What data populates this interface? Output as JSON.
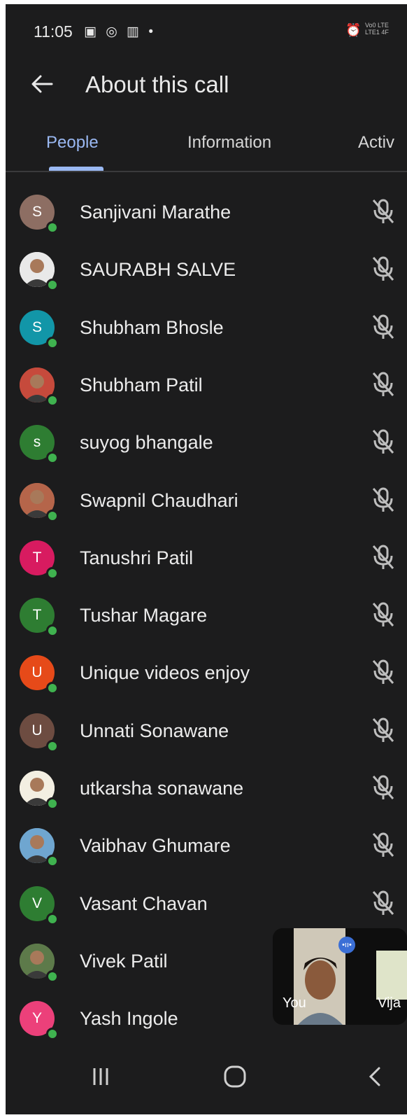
{
  "status_bar": {
    "time": "11:05",
    "left_icons": [
      "gallery-icon",
      "whatsapp-icon",
      "book-icon",
      "dot-icon"
    ],
    "right_icons": [
      "alarm-icon",
      "volte-lte-icon"
    ],
    "network_text_line1": "Vo0 LTE",
    "network_text_line2": "LTE1 4F"
  },
  "app_bar": {
    "title": "About this call"
  },
  "tabs": [
    {
      "label": "People",
      "active": true
    },
    {
      "label": "Information",
      "active": false
    },
    {
      "label": "Activ",
      "active": false
    }
  ],
  "colors": {
    "background": "#1c1c1d",
    "accent": "#9ab8f2",
    "presence": "#3fb24f"
  },
  "participants": [
    {
      "name": "Sanjivani Marathe",
      "initial": "S",
      "avatar_color": "#8d6e63",
      "photo": false,
      "mic": "muted"
    },
    {
      "name": "SAURABH SALVE",
      "initial": "",
      "avatar_color": "#e9e9e9",
      "photo": true,
      "mic": "muted"
    },
    {
      "name": "Shubham Bhosle",
      "initial": "S",
      "avatar_color": "#1296a8",
      "photo": false,
      "mic": "muted"
    },
    {
      "name": "Shubham Patil",
      "initial": "",
      "avatar_color": "#c64a3c",
      "photo": true,
      "mic": "muted"
    },
    {
      "name": "suyog bhangale",
      "initial": "s",
      "avatar_color": "#2e7d32",
      "photo": false,
      "mic": "muted"
    },
    {
      "name": "Swapnil Chaudhari",
      "initial": "",
      "avatar_color": "#b5654a",
      "photo": true,
      "mic": "muted"
    },
    {
      "name": "Tanushri Patil",
      "initial": "T",
      "avatar_color": "#d81b60",
      "photo": false,
      "mic": "muted"
    },
    {
      "name": "Tushar Magare",
      "initial": "T",
      "avatar_color": "#2e7d32",
      "photo": false,
      "mic": "muted"
    },
    {
      "name": "Unique videos enjoy",
      "initial": "U",
      "avatar_color": "#e64a19",
      "photo": false,
      "mic": "muted"
    },
    {
      "name": "Unnati Sonawane",
      "initial": "U",
      "avatar_color": "#6d4c41",
      "photo": false,
      "mic": "muted"
    },
    {
      "name": "utkarsha sonawane",
      "initial": "",
      "avatar_color": "#f3efe2",
      "photo": true,
      "mic": "muted"
    },
    {
      "name": "Vaibhav Ghumare",
      "initial": "",
      "avatar_color": "#6fa6d0",
      "photo": true,
      "mic": "muted"
    },
    {
      "name": "Vasant Chavan",
      "initial": "V",
      "avatar_color": "#2e7d32",
      "photo": false,
      "mic": "muted"
    },
    {
      "name": "Vivek Patil",
      "initial": "",
      "avatar_color": "#5d7a4a",
      "photo": true,
      "mic": "hidden"
    },
    {
      "name": "Yash Ingole",
      "initial": "Y",
      "avatar_color": "#ec407a",
      "photo": false,
      "mic": "hidden"
    }
  ],
  "self_preview": {
    "self_label": "You",
    "other_label": "Vija"
  },
  "nav_bar": {
    "buttons": [
      "recents-icon",
      "home-icon",
      "back-icon"
    ]
  }
}
